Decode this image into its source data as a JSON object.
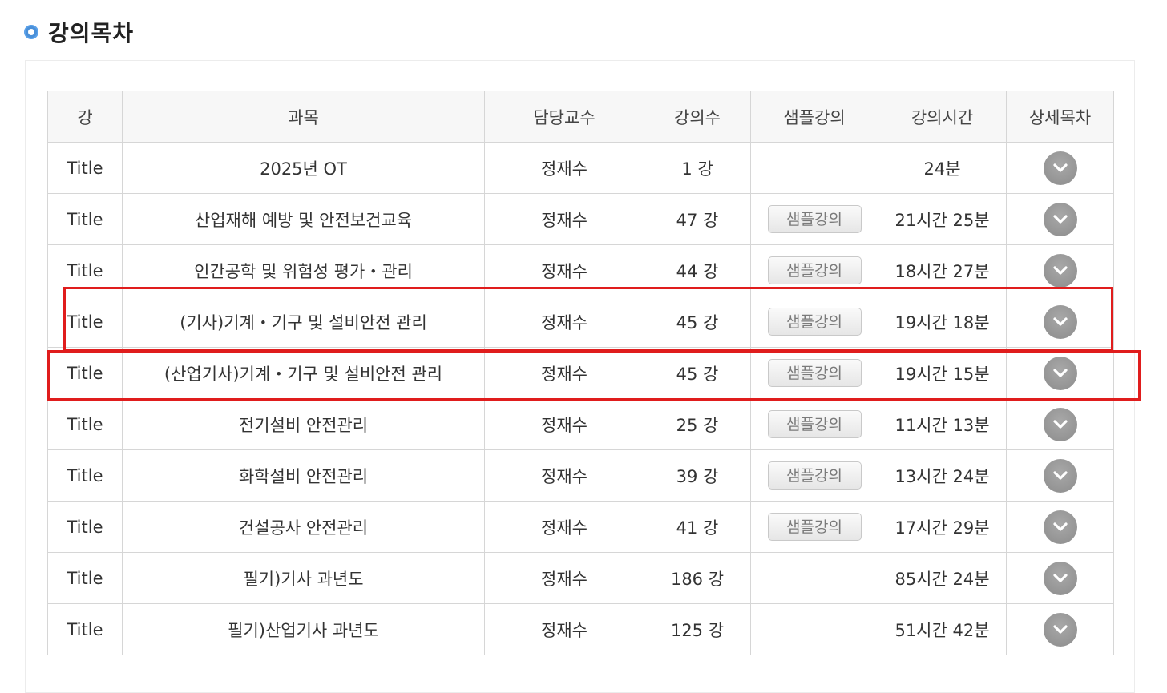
{
  "section": {
    "title": "강의목차"
  },
  "table": {
    "headers": [
      "강",
      "과목",
      "담당교수",
      "강의수",
      "샘플강의",
      "강의시간",
      "상세목차"
    ],
    "sample_label": "샘플강의",
    "rows": [
      {
        "lecture": "Title",
        "subject": "2025년 OT",
        "professor": "정재수",
        "count": "1 강",
        "has_sample": false,
        "duration": "24분"
      },
      {
        "lecture": "Title",
        "subject": "산업재해 예방 및 안전보건교육",
        "professor": "정재수",
        "count": "47 강",
        "has_sample": true,
        "duration": "21시간 25분"
      },
      {
        "lecture": "Title",
        "subject": "인간공학 및 위험성 평가・관리",
        "professor": "정재수",
        "count": "44 강",
        "has_sample": true,
        "duration": "18시간 27분"
      },
      {
        "lecture": "Title",
        "subject": "(기사)기계・기구 및 설비안전 관리",
        "professor": "정재수",
        "count": "45 강",
        "has_sample": true,
        "duration": "19시간 18분"
      },
      {
        "lecture": "Title",
        "subject": "(산업기사)기계・기구 및 설비안전 관리",
        "professor": "정재수",
        "count": "45 강",
        "has_sample": true,
        "duration": "19시간 15분"
      },
      {
        "lecture": "Title",
        "subject": "전기설비 안전관리",
        "professor": "정재수",
        "count": "25 강",
        "has_sample": true,
        "duration": "11시간 13분"
      },
      {
        "lecture": "Title",
        "subject": "화학설비 안전관리",
        "professor": "정재수",
        "count": "39 강",
        "has_sample": true,
        "duration": "13시간 24분"
      },
      {
        "lecture": "Title",
        "subject": "건설공사 안전관리",
        "professor": "정재수",
        "count": "41 강",
        "has_sample": true,
        "duration": "17시간 29분"
      },
      {
        "lecture": "Title",
        "subject": "필기)기사 과년도",
        "professor": "정재수",
        "count": "186 강",
        "has_sample": false,
        "duration": "85시간 24분"
      },
      {
        "lecture": "Title",
        "subject": "필기)산업기사 과년도",
        "professor": "정재수",
        "count": "125 강",
        "has_sample": false,
        "duration": "51시간 42분"
      }
    ]
  },
  "icons": {
    "bullet": "circle-bullet-icon",
    "detail": "chevron-down-icon"
  },
  "colors": {
    "highlight": "#e01d1d",
    "bullet": "#4a90d9",
    "header_bg": "#f7f7f7"
  }
}
